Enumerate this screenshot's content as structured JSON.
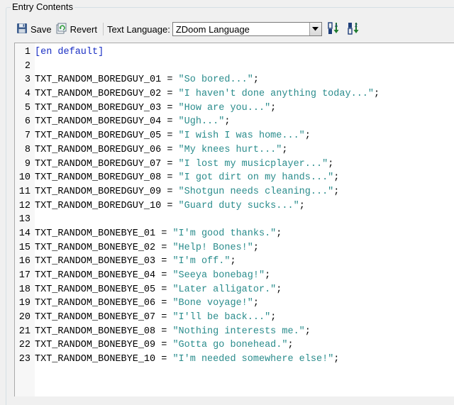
{
  "panel": {
    "title": "Entry Contents"
  },
  "toolbar": {
    "save_label": "Save",
    "revert_label": "Revert",
    "language_label": "Text Language:",
    "language_value": "ZDoom Language"
  },
  "colors": {
    "section": "#1a2fc4",
    "string": "#2a8c8c",
    "text": "#000000"
  },
  "lines": [
    {
      "num": "1",
      "section": "[en default]"
    },
    {
      "num": "2"
    },
    {
      "num": "3",
      "key": "TXT_RANDOM_BOREDGUY_01",
      "value": "\"So bored...\""
    },
    {
      "num": "4",
      "key": "TXT_RANDOM_BOREDGUY_02",
      "value": "\"I haven't done anything today...\""
    },
    {
      "num": "5",
      "key": "TXT_RANDOM_BOREDGUY_03",
      "value": "\"How are you...\""
    },
    {
      "num": "6",
      "key": "TXT_RANDOM_BOREDGUY_04",
      "value": "\"Ugh...\""
    },
    {
      "num": "7",
      "key": "TXT_RANDOM_BOREDGUY_05",
      "value": "\"I wish I was home...\""
    },
    {
      "num": "8",
      "key": "TXT_RANDOM_BOREDGUY_06",
      "value": "\"My knees hurt...\""
    },
    {
      "num": "9",
      "key": "TXT_RANDOM_BOREDGUY_07",
      "value": "\"I lost my musicplayer...\""
    },
    {
      "num": "10",
      "key": "TXT_RANDOM_BOREDGUY_08",
      "value": "\"I got dirt on my hands...\""
    },
    {
      "num": "11",
      "key": "TXT_RANDOM_BOREDGUY_09",
      "value": "\"Shotgun needs cleaning...\""
    },
    {
      "num": "12",
      "key": "TXT_RANDOM_BOREDGUY_10",
      "value": "\"Guard duty sucks...\""
    },
    {
      "num": "13"
    },
    {
      "num": "14",
      "key": "TXT_RANDOM_BONEBYE_01",
      "value": "\"I'm good thanks.\""
    },
    {
      "num": "15",
      "key": "TXT_RANDOM_BONEBYE_02",
      "value": "\"Help! Bones!\""
    },
    {
      "num": "16",
      "key": "TXT_RANDOM_BONEBYE_03",
      "value": "\"I'm off.\""
    },
    {
      "num": "17",
      "key": "TXT_RANDOM_BONEBYE_04",
      "value": "\"Seeya bonebag!\""
    },
    {
      "num": "18",
      "key": "TXT_RANDOM_BONEBYE_05",
      "value": "\"Later alligator.\""
    },
    {
      "num": "19",
      "key": "TXT_RANDOM_BONEBYE_06",
      "value": "\"Bone voyage!\""
    },
    {
      "num": "20",
      "key": "TXT_RANDOM_BONEBYE_07",
      "value": "\"I'll be back...\""
    },
    {
      "num": "21",
      "key": "TXT_RANDOM_BONEBYE_08",
      "value": "\"Nothing interests me.\""
    },
    {
      "num": "22",
      "key": "TXT_RANDOM_BONEBYE_09",
      "value": "\"Gotta go bonehead.\""
    },
    {
      "num": "23",
      "key": "TXT_RANDOM_BONEBYE_10",
      "value": "\"I'm needed somewhere else!\""
    }
  ]
}
